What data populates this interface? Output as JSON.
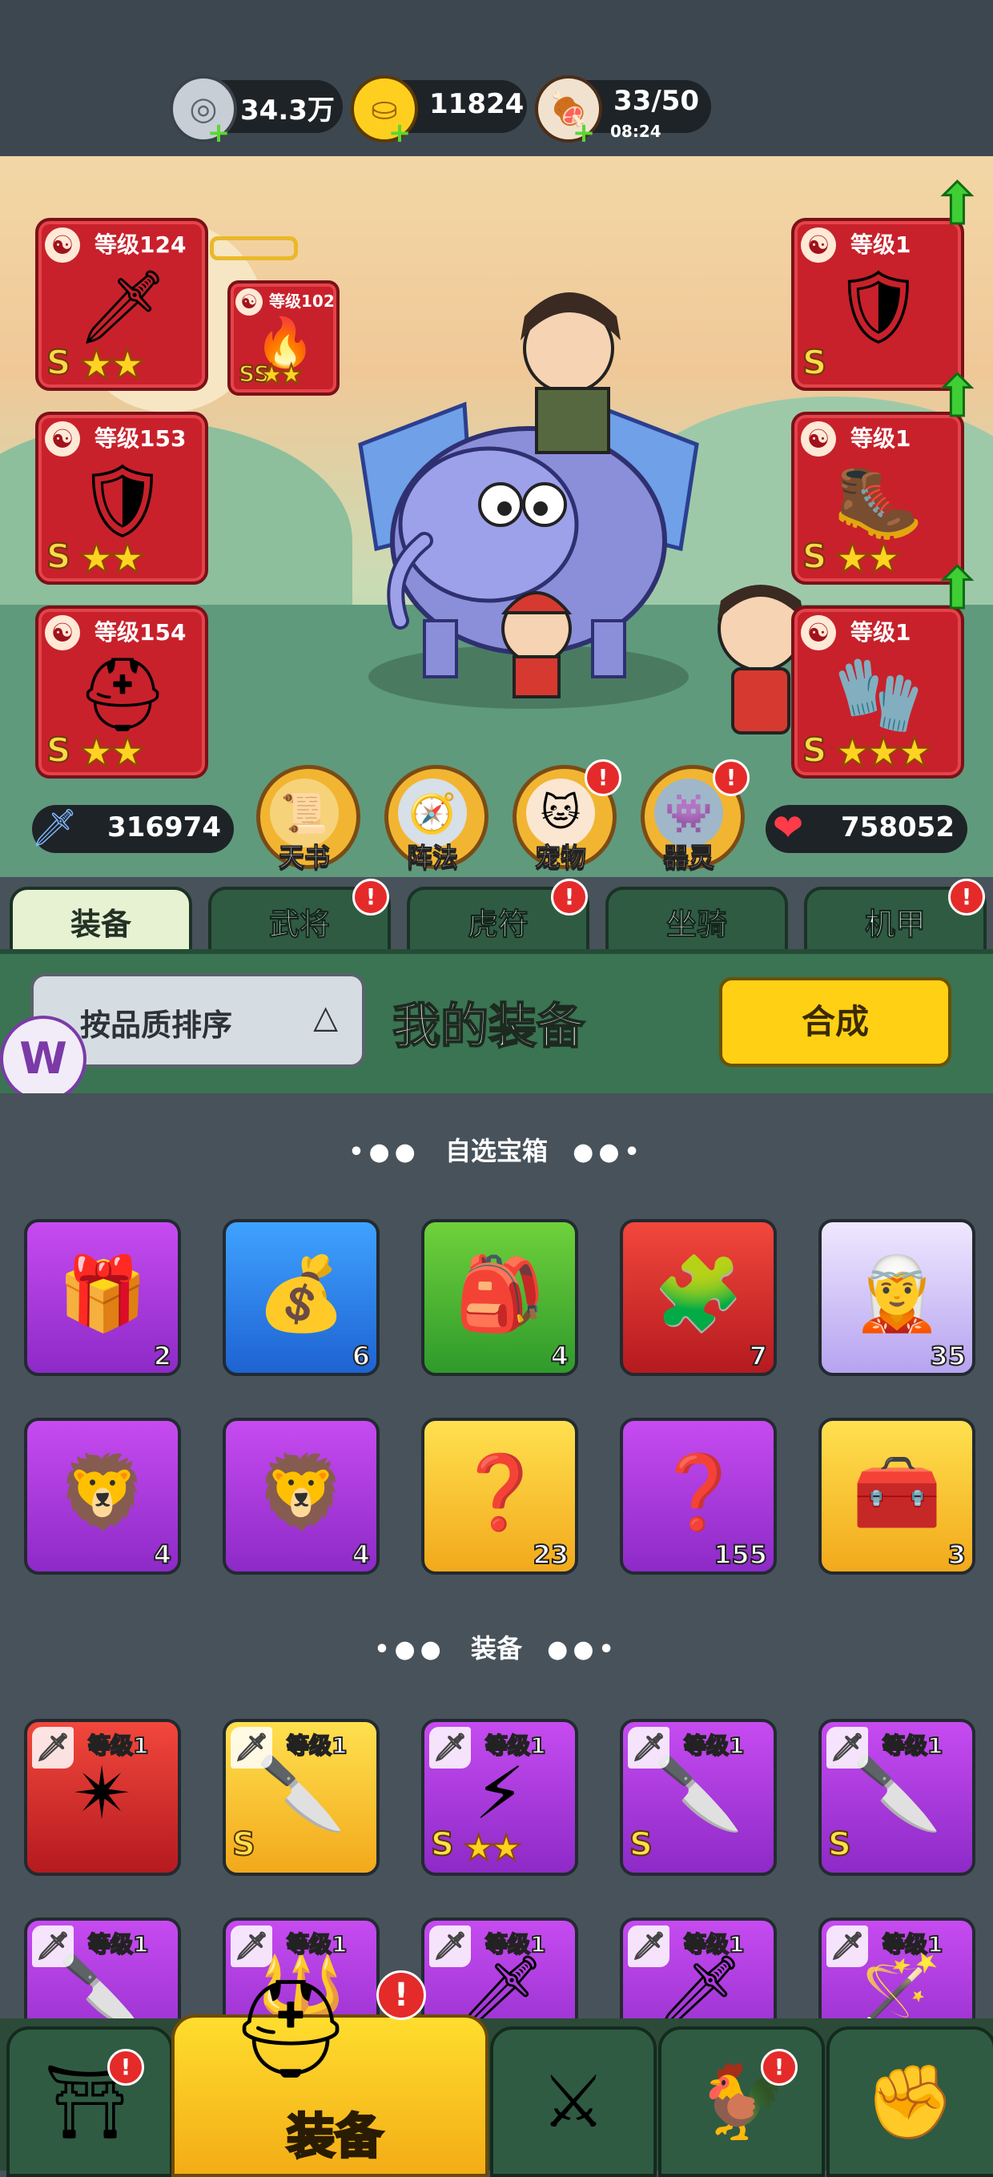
{
  "resources": [
    {
      "icon": "silver-coin-icon",
      "value": "34.3万"
    },
    {
      "icon": "gold-ingot-icon",
      "value": "11824"
    },
    {
      "icon": "meat-stamina-icon",
      "value": "33/50",
      "timer": "08:24"
    }
  ],
  "left_equipment": [
    {
      "level": "等级124",
      "grade": "S",
      "stars": 2,
      "icon": "sword-icon"
    },
    {
      "level": "等级153",
      "grade": "S",
      "stars": 2,
      "icon": "beast-armor-icon"
    },
    {
      "level": "等级154",
      "grade": "S",
      "stars": 2,
      "icon": "helmet-icon"
    }
  ],
  "linked_equipment": {
    "level": "等级102",
    "grade": "SS",
    "stars": 2,
    "icon": "flame-flower-icon"
  },
  "right_equipment": [
    {
      "level": "等级1",
      "grade": "S",
      "stars": 0,
      "icon": "armor-icon"
    },
    {
      "level": "等级1",
      "grade": "S",
      "stars": 2,
      "icon": "boots-icon"
    },
    {
      "level": "等级1",
      "grade": "S",
      "stars": 3,
      "icon": "gauntlet-icon"
    }
  ],
  "stats": {
    "attack": "316974",
    "hp": "758052"
  },
  "features": [
    {
      "label": "天书",
      "badge": false
    },
    {
      "label": "阵法",
      "badge": false
    },
    {
      "label": "宠物",
      "badge": true
    },
    {
      "label": "器灵",
      "badge": true
    }
  ],
  "tabs": [
    {
      "label": "装备",
      "active": true,
      "badge": false
    },
    {
      "label": "武将",
      "active": false,
      "badge": true
    },
    {
      "label": "虎符",
      "active": false,
      "badge": true
    },
    {
      "label": "坐骑",
      "active": false,
      "badge": false
    },
    {
      "label": "机甲",
      "active": false,
      "badge": true
    }
  ],
  "sort_button": "按品质排序",
  "panel_title": "我的装备",
  "synthesize_button": "合成",
  "section_chests": "自选宝箱",
  "chests": [
    {
      "color": "purple",
      "count": "2",
      "icon": "gift-cards-icon"
    },
    {
      "color": "blue",
      "count": "6",
      "icon": "treasure-pile-icon"
    },
    {
      "color": "green",
      "count": "4",
      "icon": "supplies-icon"
    },
    {
      "color": "red",
      "count": "7",
      "icon": "red-puzzle-mask-icon"
    },
    {
      "color": "lilac",
      "count": "35",
      "icon": "hero-puzzle-icon"
    },
    {
      "color": "purple",
      "count": "4",
      "icon": "lion-chest-icon"
    },
    {
      "color": "purple",
      "count": "4",
      "icon": "lion-chest-icon"
    },
    {
      "color": "gold",
      "count": "23",
      "icon": "mystery-chest-icon"
    },
    {
      "color": "purple",
      "count": "155",
      "icon": "mystery-chest-icon"
    },
    {
      "color": "gold",
      "count": "3",
      "icon": "puzzle-chest-icon"
    }
  ],
  "section_equipment": "装备",
  "equipment_items": [
    {
      "color": "red",
      "level": "等级1",
      "grade": "",
      "stars": 0,
      "icon": "shuriken-icon"
    },
    {
      "color": "gold",
      "level": "等级1",
      "grade": "S",
      "stars": 0,
      "icon": "curved-blade-icon"
    },
    {
      "color": "purple",
      "level": "等级1",
      "grade": "S",
      "stars": 2,
      "icon": "lightning-spear-icon"
    },
    {
      "color": "purple",
      "level": "等级1",
      "grade": "S",
      "stars": 0,
      "icon": "curved-blade-icon"
    },
    {
      "color": "purple",
      "level": "等级1",
      "grade": "S",
      "stars": 0,
      "icon": "curved-blade-icon"
    },
    {
      "color": "purple",
      "level": "等级1",
      "grade": "",
      "stars": 0,
      "icon": "curved-blade-icon"
    },
    {
      "color": "purple",
      "level": "等级1",
      "grade": "",
      "stars": 0,
      "icon": "spear-icon"
    },
    {
      "color": "purple",
      "level": "等级1",
      "grade": "",
      "stars": 0,
      "icon": "broadsword-icon"
    },
    {
      "color": "purple",
      "level": "等级1",
      "grade": "",
      "stars": 0,
      "icon": "broadsword-icon"
    },
    {
      "color": "purple",
      "level": "等级1",
      "grade": "",
      "stars": 0,
      "icon": "staff-icon"
    }
  ],
  "bottom_nav": [
    {
      "label": "",
      "icon": "gate-shop-icon",
      "badge": true
    },
    {
      "label": "装备",
      "icon": "helmet-icon",
      "badge": true,
      "active": true
    },
    {
      "label": "",
      "icon": "crossed-swords-shield-icon",
      "badge": false
    },
    {
      "label": "",
      "icon": "rooster-icon",
      "badge": true
    },
    {
      "label": "",
      "icon": "upgrade-fist-icon",
      "badge": false
    }
  ]
}
